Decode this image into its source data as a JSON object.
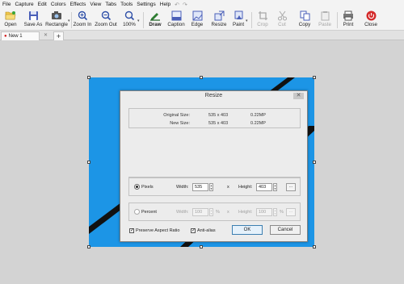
{
  "menu": [
    "File",
    "Capture",
    "Edit",
    "Colors",
    "Effects",
    "View",
    "Tabs",
    "Tools",
    "Settings",
    "Help"
  ],
  "toolbar": {
    "open": "Open",
    "save_as": "Save As",
    "rectangle": "Rectangle",
    "zoom_in": "Zoom In",
    "zoom_out": "Zoom Out",
    "zoom_level": "100%",
    "draw": "Draw",
    "caption": "Caption",
    "edge": "Edge",
    "resize": "Resize",
    "paint": "Paint",
    "crop": "Crop",
    "cut": "Cut",
    "copy": "Copy",
    "paste": "Paste",
    "print": "Print",
    "close": "Close"
  },
  "tabs": {
    "doc": "New 1",
    "add": "+",
    "close": "✕"
  },
  "dialog": {
    "title": "Resize",
    "close": "✕",
    "original_size_label": "Original Size:",
    "original_size": "535 x 403",
    "original_mp": "0.22MP",
    "new_size_label": "New Size:",
    "new_size": "535 x 403",
    "new_mp": "0.22MP",
    "pixels_label": "Pixels",
    "width_label": "Width:",
    "width_px": "535",
    "x_sep": "x",
    "height_label": "Height:",
    "height_px": "403",
    "ellipsis": "...",
    "percent_label": "Percent",
    "width_pct": "100",
    "height_pct": "100",
    "pct_unit": "%",
    "preserve_label": "Preserve Aspect Ratio",
    "antialias_label": "Anti-alias",
    "ok": "OK",
    "cancel": "Cancel"
  }
}
